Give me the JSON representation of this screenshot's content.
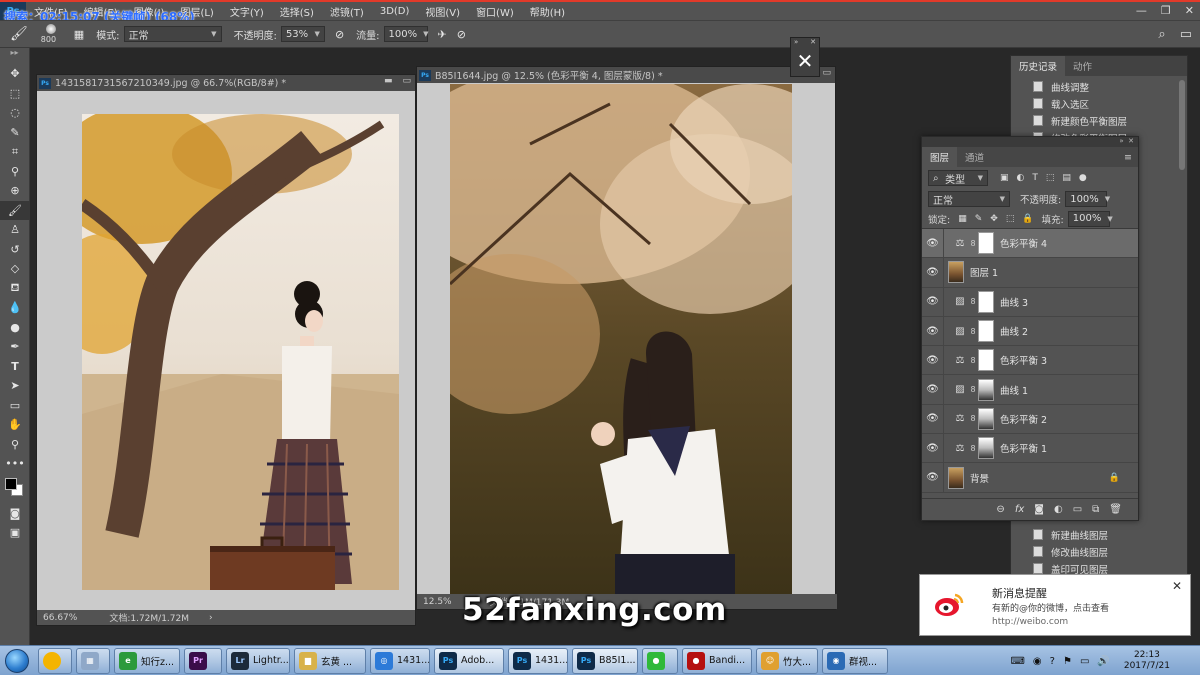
{
  "overlay": {
    "search_text": "搜索：02:15:07 (关键帧) (68%)"
  },
  "menu": {
    "items": [
      "文件(F)",
      "编辑(E)",
      "图像(I)",
      "图层(L)",
      "文字(Y)",
      "选择(S)",
      "滤镜(T)",
      "3D(D)",
      "视图(V)",
      "窗口(W)",
      "帮助(H)"
    ]
  },
  "options": {
    "brush_size": "800",
    "mode_label": "模式:",
    "mode_value": "正常",
    "opacity_label": "不透明度:",
    "opacity_value": "53%",
    "flow_label": "流量:",
    "flow_value": "100%"
  },
  "doc1": {
    "title": "1431581731567210349.jpg @ 66.7%(RGB/8#) *",
    "zoom": "66.67%",
    "info": "文档:1.72M/1.72M"
  },
  "doc2": {
    "title": "B85I1644.jpg @ 12.5% (色彩平衡 4, 图层蒙版/8) *",
    "zoom": "12.5%",
    "info": "文档:7.1M/171.3M"
  },
  "history": {
    "tabs": [
      "历史记录",
      "动作"
    ],
    "items": [
      "曲线调整",
      "载入选区",
      "新建颜色平衡图层",
      "修改色彩平衡图层",
      "新建曲线图层",
      "修改曲线图层",
      "盖印可见图层"
    ]
  },
  "layers": {
    "tabs": [
      "图层",
      "通道"
    ],
    "filter_kind": "类型",
    "blend_mode": "正常",
    "opacity_label": "不透明度:",
    "opacity_value": "100%",
    "lock_label": "锁定:",
    "fill_label": "填充:",
    "fill_value": "100%",
    "rows": [
      {
        "name": "色彩平衡 4",
        "kind": "balance",
        "selected": true
      },
      {
        "name": "图层 1",
        "kind": "pixel"
      },
      {
        "name": "曲线 3",
        "kind": "curves"
      },
      {
        "name": "曲线 2",
        "kind": "curves"
      },
      {
        "name": "色彩平衡 3",
        "kind": "balance"
      },
      {
        "name": "曲线 1",
        "kind": "curves"
      },
      {
        "name": "色彩平衡 2",
        "kind": "balance"
      },
      {
        "name": "色彩平衡 1",
        "kind": "balance"
      },
      {
        "name": "背景",
        "kind": "pixel"
      }
    ]
  },
  "watermark": "52fanxing.com",
  "notification": {
    "title": "新消息提醒",
    "body": "有新的@你的微博，点击查看",
    "url": "http://weibo.com"
  },
  "taskbar": {
    "buttons": [
      {
        "label": "知行z...",
        "icon": "browser-icon",
        "color": "#2c9a3c"
      },
      {
        "label": "",
        "icon": "premiere-icon",
        "color": "#3a0d4a"
      },
      {
        "label": "Lightr...",
        "icon": "lightroom-icon",
        "color": "#1c2a3a"
      },
      {
        "label": "玄黄 ...",
        "icon": "folder-icon",
        "color": "#d8b24a"
      },
      {
        "label": "1431...",
        "icon": "viewer-icon",
        "color": "#2c7ad8"
      },
      {
        "label": "Adob...",
        "icon": "photoshop-icon",
        "color": "#0e2a48"
      },
      {
        "label": "1431...",
        "icon": "photoshop-icon",
        "color": "#0e2a48"
      },
      {
        "label": "B85I1...",
        "icon": "photoshop-icon",
        "color": "#0e2a48"
      },
      {
        "label": "",
        "icon": "wechat-icon",
        "color": "#2fb93a"
      },
      {
        "label": "Bandi...",
        "icon": "record-icon",
        "color": "#b51010"
      },
      {
        "label": "竹大...",
        "icon": "chat-icon",
        "color": "#e0a030"
      },
      {
        "label": "群视...",
        "icon": "video-icon",
        "color": "#2a6ab5"
      }
    ],
    "clock_time": "22:13",
    "clock_date": "2017/7/21"
  }
}
